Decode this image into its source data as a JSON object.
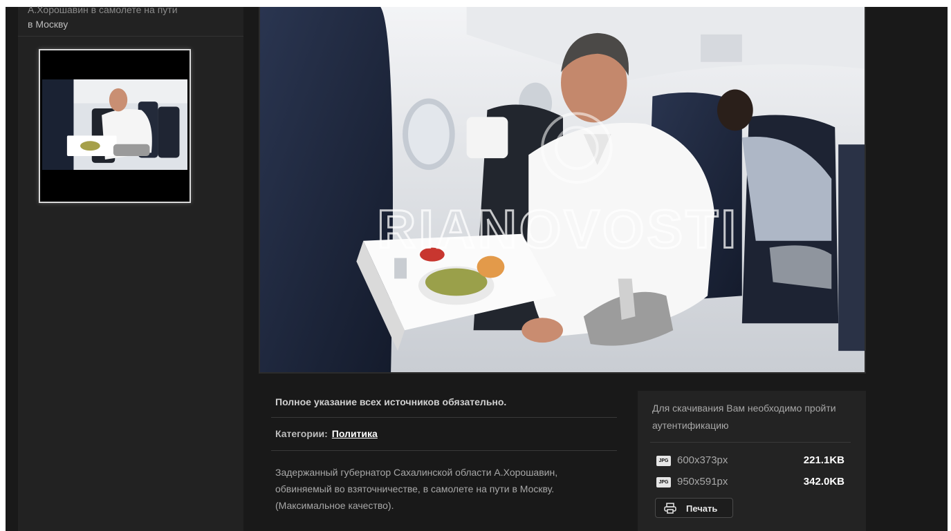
{
  "sidebar": {
    "caption_line1": "А.Хорошавин в самолете на пути",
    "caption_line2": "в Москву"
  },
  "photo": {
    "watermark": "RIANOVOSTI"
  },
  "info": {
    "source_note": "Полное указание всех источников обязательно.",
    "categories_label": "Категории:",
    "category_link": "Политика",
    "description": "Задержанный губернатор Сахалинской области А.Хорошавин, обвиняемый во взяточничестве, в самолете на пути в Москву. (Максимальное качество)."
  },
  "download": {
    "auth_note": "Для скачивания Вам необходимо пройти аутентификацию",
    "files": [
      {
        "icon": "jpg-file-icon",
        "size": "600x373px",
        "weight": "221.1KB"
      },
      {
        "icon": "jpg-file-icon",
        "size": "950x591px",
        "weight": "342.0KB"
      }
    ],
    "print_label": "Печать"
  }
}
